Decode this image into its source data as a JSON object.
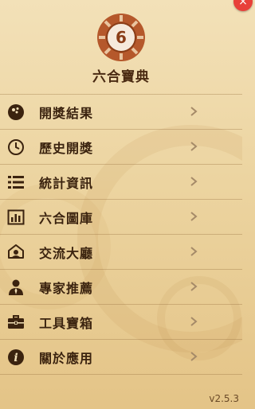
{
  "app": {
    "title": "六合寶典",
    "version": "v2.5.3",
    "logo_digit": "6"
  },
  "close_icon": "×",
  "colors": {
    "accent": "#b5582b",
    "text": "#3b230f",
    "close": "#e8403a"
  },
  "menu": [
    {
      "label": "開獎結果",
      "icon": "ball-icon"
    },
    {
      "label": "歷史開獎",
      "icon": "clock-icon"
    },
    {
      "label": "統計資訊",
      "icon": "list-icon"
    },
    {
      "label": "六合圖庫",
      "icon": "chart-icon"
    },
    {
      "label": "交流大廳",
      "icon": "chat-icon"
    },
    {
      "label": "專家推薦",
      "icon": "expert-icon"
    },
    {
      "label": "工具寶箱",
      "icon": "toolbox-icon"
    },
    {
      "label": "關於應用",
      "icon": "info-icon"
    }
  ]
}
